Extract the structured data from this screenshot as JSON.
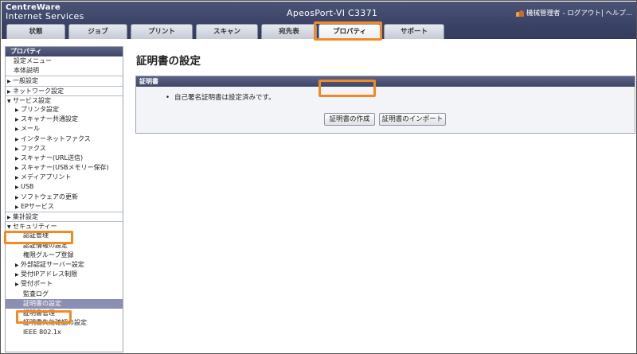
{
  "header": {
    "logo_line1": "CentreWare",
    "logo_line2": "Internet Services",
    "model": "ApeosPort-VI C3371",
    "user": "機械管理者",
    "links": "- ログアウト| ヘルプ..."
  },
  "tabs": [
    {
      "label": "状態"
    },
    {
      "label": "ジョブ"
    },
    {
      "label": "プリント"
    },
    {
      "label": "スキャン"
    },
    {
      "label": "宛先表"
    },
    {
      "label": "プロパティ",
      "active": true
    },
    {
      "label": "サポート"
    }
  ],
  "sidebar": {
    "title": "プロパティ",
    "items": [
      {
        "label": "設定メニュー"
      },
      {
        "label": "本体説明"
      },
      {
        "label": "一般設定"
      },
      {
        "label": "ネットワーク設定"
      },
      {
        "label": "サービス設定"
      },
      {
        "label": "プリンタ設定"
      },
      {
        "label": "スキャナー共通設定"
      },
      {
        "label": "メール"
      },
      {
        "label": "インターネットファクス"
      },
      {
        "label": "ファクス"
      },
      {
        "label": "スキャナー(URL送信)"
      },
      {
        "label": "スキャナー(USBメモリー保存)"
      },
      {
        "label": "メディアプリント"
      },
      {
        "label": "USB"
      },
      {
        "label": "ソフトウェアの更新"
      },
      {
        "label": "EPサービス"
      },
      {
        "label": "集計設定"
      },
      {
        "label": "セキュリティー"
      },
      {
        "label": "認証管理"
      },
      {
        "label": "認証情報の設定"
      },
      {
        "label": "権限グループ登録"
      },
      {
        "label": "外部認証サーバー設定"
      },
      {
        "label": "受付IPアドレス制限"
      },
      {
        "label": "受付ポート"
      },
      {
        "label": "監査ログ"
      },
      {
        "label": "証明書の設定"
      },
      {
        "label": "証明書管理"
      },
      {
        "label": "証明書失効確認の設定"
      },
      {
        "label": "IEEE 802.1x"
      }
    ]
  },
  "main": {
    "title": "証明書の設定",
    "panel_title": "証明書",
    "message": "自己署名証明書は設定済みです。",
    "create_button": "証明書の作成",
    "import_button": "証明書のインポート"
  },
  "colors": {
    "header_bg": "#3a4266",
    "highlight": "#f08a24",
    "selected_bg": "#8b8fb3"
  }
}
